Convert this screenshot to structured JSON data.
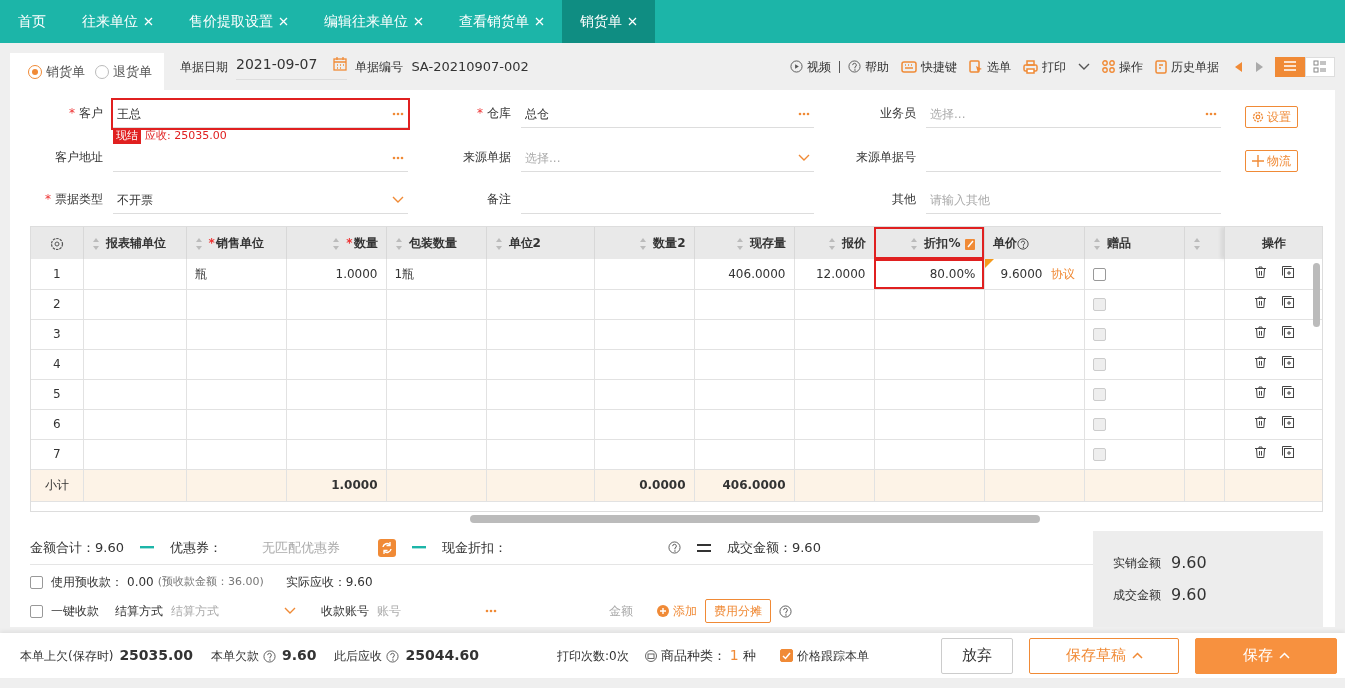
{
  "tabs": [
    {
      "label": "首页",
      "closable": false,
      "selected": false
    },
    {
      "label": "往来单位",
      "closable": true,
      "selected": false
    },
    {
      "label": "售价提取设置",
      "closable": true,
      "selected": false
    },
    {
      "label": "编辑往来单位",
      "closable": true,
      "selected": false
    },
    {
      "label": "查看销货单",
      "closable": true,
      "selected": false
    },
    {
      "label": "销货单",
      "closable": true,
      "selected": true
    }
  ],
  "doc_types": [
    {
      "label": "销货单",
      "selected": true
    },
    {
      "label": "退货单",
      "selected": false
    }
  ],
  "header": {
    "date_label": "单据日期",
    "date": "2021-09-07",
    "number_label": "单据编号",
    "number": "SA-20210907-002"
  },
  "toolbar": [
    {
      "kind": "play",
      "label": "视频",
      "dropdown": false
    },
    {
      "kind": "help",
      "label": "帮助",
      "dropdown": false
    },
    {
      "kind": "keyboard",
      "label": "快捷键",
      "dropdown": false
    },
    {
      "kind": "pick",
      "label": "选单",
      "dropdown": false
    },
    {
      "kind": "print",
      "label": "打印",
      "dropdown": true
    },
    {
      "kind": "grid",
      "label": "操作",
      "dropdown": false
    },
    {
      "kind": "history",
      "label": "历史单据",
      "dropdown": false
    }
  ],
  "views": [
    {
      "kind": "list",
      "selected": true
    },
    {
      "kind": "cards",
      "selected": false
    }
  ],
  "side_buttons": [
    {
      "kind": "gear",
      "label": "设置"
    },
    {
      "kind": "plus",
      "label": "物流"
    }
  ],
  "form_rows": [
    {
      "fields": [
        {
          "label": "客户",
          "required_mark": "*",
          "value": "王总",
          "kind": "lookup",
          "highlighted": true
        },
        {
          "label": "仓库",
          "required_mark": "*",
          "value": "总仓",
          "kind": "lookup",
          "highlighted": false
        },
        {
          "label": "业务员",
          "placeholder": "选择...",
          "kind": "lookup",
          "highlighted": false
        }
      ],
      "tags": [
        {
          "kind": "solid",
          "text": "现结"
        },
        {
          "kind": "plain",
          "text": "应收: 25035.00"
        }
      ]
    },
    {
      "fields": [
        {
          "label": "客户地址",
          "kind": "lookup",
          "highlighted": false
        },
        {
          "label": "来源单据",
          "placeholder": "选择...",
          "kind": "select",
          "highlighted": false
        },
        {
          "label": "来源单据号",
          "kind": "text",
          "highlighted": false
        }
      ]
    },
    {
      "fields": [
        {
          "label": "票据类型",
          "required_mark": "*",
          "value": "不开票",
          "kind": "select",
          "highlighted": false
        },
        {
          "label": "备注",
          "kind": "text",
          "highlighted": false
        },
        {
          "label": "其他",
          "placeholder": "请输入其他",
          "kind": "text",
          "highlighted": false
        }
      ]
    }
  ],
  "table": {
    "columns": [
      {
        "kind": "rownum",
        "sortable": false,
        "highlighted": false
      },
      {
        "kind": "text",
        "label": "报表辅单位",
        "sortable": true,
        "highlighted": false
      },
      {
        "kind": "text",
        "label": "销售单位",
        "required_mark": "*",
        "sortable": true,
        "highlighted": false
      },
      {
        "kind": "number",
        "label": "数量",
        "required_mark": "*",
        "sortable": true,
        "highlighted": false,
        "subtotal": "1.0000"
      },
      {
        "kind": "text",
        "label": "包装数量",
        "sortable": true,
        "highlighted": false
      },
      {
        "kind": "text",
        "label": "单位2",
        "sortable": true,
        "highlighted": false
      },
      {
        "kind": "number",
        "label": "数量2",
        "sortable": true,
        "highlighted": false,
        "subtotal": "0.0000"
      },
      {
        "kind": "number",
        "label": "现存量",
        "sortable": true,
        "highlighted": false,
        "subtotal": "406.0000"
      },
      {
        "kind": "number",
        "label": "报价",
        "sortable": true,
        "highlighted": false
      },
      {
        "kind": "discount",
        "label": "折扣%",
        "sortable": true,
        "highlighted": true
      },
      {
        "kind": "price",
        "label": "单价",
        "sortable": false,
        "highlighted": false
      },
      {
        "kind": "gift",
        "label": "赠品",
        "sortable": true,
        "highlighted": false
      },
      {
        "kind": "spacer",
        "sortable": true,
        "highlighted": false
      },
      {
        "kind": "ops",
        "label": "操作",
        "sortable": false,
        "highlighted": false
      }
    ],
    "rows": [
      {
        "cells": [
          "1",
          null,
          "瓶",
          "1.0000",
          "1瓶",
          null,
          null,
          "406.0000",
          "12.0000",
          "80.00%",
          "9.6000"
        ],
        "tag": "协议",
        "flagged": true,
        "gift_checked": false,
        "gift_disabled": false
      },
      {
        "cells": [
          "2"
        ],
        "flagged": false,
        "gift_checked": false,
        "gift_disabled": true
      },
      {
        "cells": [
          "3"
        ],
        "flagged": false,
        "gift_checked": false,
        "gift_disabled": true
      },
      {
        "cells": [
          "4"
        ],
        "flagged": false,
        "gift_checked": false,
        "gift_disabled": true
      },
      {
        "cells": [
          "5"
        ],
        "flagged": false,
        "gift_checked": false,
        "gift_disabled": true
      },
      {
        "cells": [
          "6"
        ],
        "flagged": false,
        "gift_checked": false,
        "gift_disabled": true
      },
      {
        "cells": [
          "7"
        ],
        "flagged": false,
        "gift_checked": false,
        "gift_disabled": true
      }
    ],
    "subtotal_label": "小计"
  },
  "summary": {
    "total": "金额合计：9.60",
    "coupon_label": "优惠券：",
    "coupon_placeholder": "无匹配优惠券",
    "cash_discount": "现金折扣：",
    "deal": "成交金额：9.60",
    "prepaid": {
      "checked": false,
      "label": "使用预收款：",
      "value": "0.00",
      "note": "(预收款金额：36.00)"
    },
    "actual": "实际应收：9.60",
    "quick_pay": {
      "checked": false,
      "label": "一键收款"
    },
    "method_label": "结算方式",
    "method_placeholder": "结算方式",
    "account_label": "收款账号",
    "account_placeholder": "账号",
    "amount_label": "金额",
    "add": "添加",
    "split": "费用分摊"
  },
  "totals_box": [
    {
      "label": "实销金额",
      "value": "9.60"
    },
    {
      "label": "成交金额",
      "value": "9.60"
    }
  ],
  "footer": {
    "stats": [
      {
        "label": "本单上欠(保存时)",
        "help": false,
        "value": "25035.00"
      },
      {
        "label": "本单欠款",
        "help": true,
        "value": "9.60"
      },
      {
        "label": "此后应收",
        "help": true,
        "value": "25044.60"
      }
    ],
    "print_count": "打印次数:0次",
    "types_label": "商品种类：",
    "types_value": "1",
    "types_unit": "种",
    "track": {
      "label": "价格跟踪本单",
      "checked": true
    },
    "buttons": [
      {
        "label": "放弃",
        "kind": "plain",
        "caret": false
      },
      {
        "label": "保存草稿",
        "kind": "outline",
        "caret": true
      },
      {
        "label": "保存",
        "kind": "primary",
        "caret": true
      }
    ]
  }
}
